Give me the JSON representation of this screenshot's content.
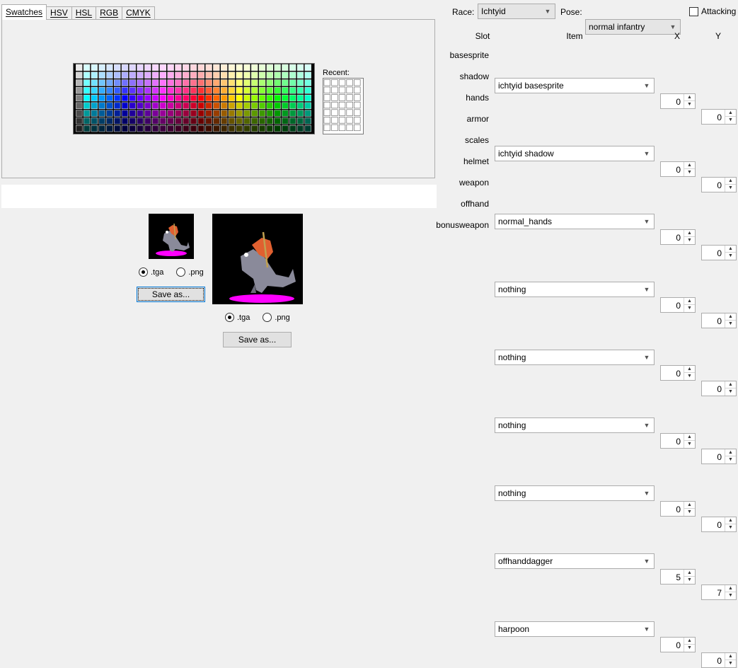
{
  "tabs": [
    {
      "label": "Swatches",
      "active": true
    },
    {
      "label": "HSV",
      "active": false
    },
    {
      "label": "HSL",
      "active": false
    },
    {
      "label": "RGB",
      "active": false
    },
    {
      "label": "CMYK",
      "active": false
    }
  ],
  "recent_label": "Recent:",
  "export_small": {
    "option1": ".tga",
    "option2": ".png",
    "selected": ".tga",
    "save_label": "Save as..."
  },
  "export_large": {
    "option1": ".tga",
    "option2": ".png",
    "selected": ".tga",
    "save_label": "Save as..."
  },
  "race": {
    "label": "Race:",
    "value": "Ichtyid"
  },
  "pose": {
    "label": "Pose:",
    "value": "normal infantry"
  },
  "attacking": {
    "label": "Attacking",
    "checked": false
  },
  "columns": {
    "slot": "Slot",
    "item": "Item",
    "x": "X",
    "y": "Y"
  },
  "slots": [
    {
      "slot": "basesprite",
      "item": "ichtyid basesprite",
      "x": "0",
      "y": "0"
    },
    {
      "slot": "shadow",
      "item": "ichtyid shadow",
      "x": "0",
      "y": "0"
    },
    {
      "slot": "hands",
      "item": "normal_hands",
      "x": "0",
      "y": "0"
    },
    {
      "slot": "armor",
      "item": "nothing",
      "x": "0",
      "y": "0"
    },
    {
      "slot": "scales",
      "item": "nothing",
      "x": "0",
      "y": "0"
    },
    {
      "slot": "helmet",
      "item": "nothing",
      "x": "0",
      "y": "0"
    },
    {
      "slot": "weapon",
      "item": "nothing",
      "x": "0",
      "y": "0"
    },
    {
      "slot": "offhand",
      "item": "offhanddagger",
      "x": "5",
      "y": "7"
    },
    {
      "slot": "bonusweapon",
      "item": "harpoon",
      "x": "0",
      "y": "0"
    }
  ],
  "icons": {
    "dropdown": "chevron-down-icon",
    "spin_up": "arrow-up-icon",
    "spin_down": "arrow-down-icon"
  },
  "colors": {
    "preview_bg": "#000000",
    "shadow_magenta": "#ff00ff",
    "creature_gray": "#8a8a9a",
    "fin_orange": "#e06030"
  }
}
